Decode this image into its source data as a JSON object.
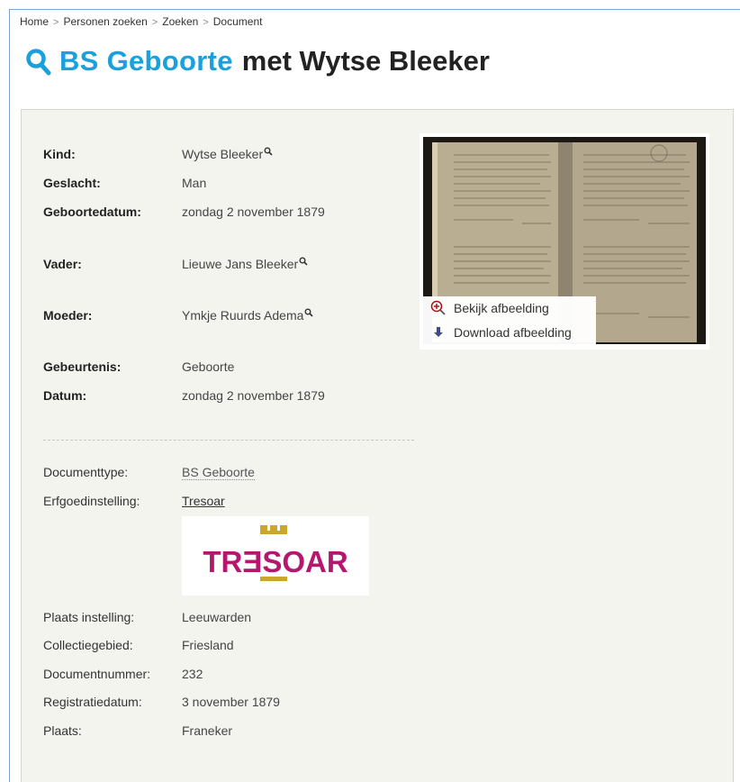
{
  "breadcrumb": [
    "Home",
    "Personen zoeken",
    "Zoeken",
    "Document"
  ],
  "breadcrumb_sep": ">",
  "title": {
    "brand": "BS Geboorte",
    "rest": "met Wytse Bleeker",
    "icon": "search-icon",
    "brand_color": "#1aa0dc"
  },
  "record": {
    "kind": {
      "label": "Kind:",
      "value": "Wytse Bleeker"
    },
    "geslacht": {
      "label": "Geslacht:",
      "value": "Man"
    },
    "geboortedatum": {
      "label": "Geboortedatum:",
      "value": "zondag 2 november 1879"
    },
    "vader": {
      "label": "Vader:",
      "value": "Lieuwe Jans Bleeker"
    },
    "moeder": {
      "label": "Moeder:",
      "value": "Ymkje Ruurds Adema"
    },
    "gebeurtenis": {
      "label": "Gebeurtenis:",
      "value": "Geboorte"
    },
    "datum": {
      "label": "Datum:",
      "value": "zondag 2 november 1879"
    }
  },
  "document": {
    "documenttype": {
      "label": "Documenttype:",
      "value": "BS Geboorte"
    },
    "erfgoedinstelling": {
      "label": "Erfgoedinstelling:",
      "value": "Tresoar"
    },
    "logo_text": "TRƎSOAR",
    "plaats_instelling": {
      "label": "Plaats instelling:",
      "value": "Leeuwarden"
    },
    "collectiegebied": {
      "label": "Collectiegebied:",
      "value": "Friesland"
    },
    "documentnummer": {
      "label": "Documentnummer:",
      "value": "232"
    },
    "registratiedatum": {
      "label": "Registratiedatum:",
      "value": "3 november 1879"
    },
    "plaats": {
      "label": "Plaats:",
      "value": "Franeker"
    }
  },
  "image_actions": {
    "view": "Bekijk afbeelding",
    "download": "Download afbeelding"
  },
  "colors": {
    "panel_bg": "#f4f4ef",
    "logo_magenta": "#b5176e",
    "logo_gold": "#c8a72a"
  }
}
